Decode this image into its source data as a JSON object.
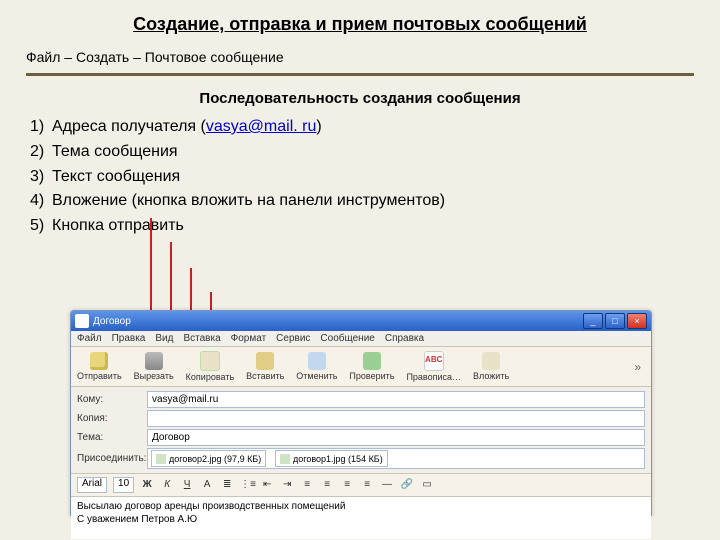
{
  "page_title": "Создание, отправка и прием почтовых сообщений",
  "breadcrumb": "Файл – Создать – Почтовое сообщение",
  "subhead": "Последовательность создания сообщения",
  "steps": {
    "s1_num": "1)",
    "s1_a": "Адреса получателя (",
    "s1_link": "vasya@mail. ru",
    "s1_b": ")",
    "s2_num": "2)",
    "s2": "Тема сообщения",
    "s3_num": "3)",
    "s3": "Текст сообщения",
    "s4_num": "4)",
    "s4": "Вложение (кнопка вложить на панели инструментов)",
    "s5_num": "5)",
    "s5": "Кнопка отправить"
  },
  "win": {
    "title_icon": "✉",
    "title": "Договор",
    "cap_min": "_",
    "cap_max": "□",
    "cap_close": "×",
    "menu": {
      "file": "Файл",
      "edit": "Правка",
      "view": "Вид",
      "insert": "Вставка",
      "format": "Формат",
      "tools": "Сервис",
      "message": "Сообщение",
      "help": "Справка"
    },
    "toolbar": {
      "send": "Отправить",
      "cut": "Вырезать",
      "copy": "Копировать",
      "paste": "Вставить",
      "undo": "Отменить",
      "check": "Проверить",
      "spell": "Правописа…",
      "abc_icon": "ABC",
      "attach": "Вложить",
      "chevron": "»"
    },
    "fields": {
      "to_label": "Кому:",
      "to_value": "vasya@mail.ru",
      "cc_label": "Копия:",
      "cc_value": "",
      "subj_label": "Тема:",
      "subj_value": "Договор",
      "attach_label": "Присоединить:",
      "attach1": "договор2.jpg (97,9 КБ)",
      "attach2": "договор1.jpg (154 КБ)"
    },
    "fmt": {
      "font": "Arial",
      "size": "10",
      "b": "Ж",
      "i": "К",
      "u": "Ч",
      "a": "A",
      "bullets": "≣",
      "num": "⋮≡",
      "out": "⇤",
      "in": "⇥",
      "al": "≡",
      "ac": "≡",
      "ar": "≡",
      "aj": "≡",
      "hr": "―",
      "link": "🔗",
      "img": "▭"
    },
    "body": {
      "l1": "Высылаю договор аренды производственных помещений",
      "l2": "С уважением Петров А.Ю"
    }
  }
}
